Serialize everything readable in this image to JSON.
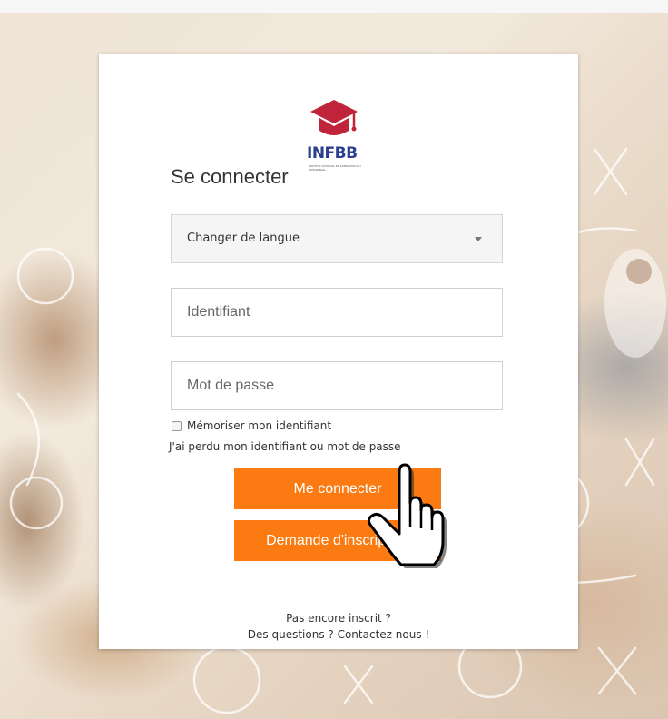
{
  "brand": {
    "logo_text": "INFBB",
    "logo_subtext": "INSTITUT NATIONAL DE FORMATION DU BASKETBALL",
    "primary_color": "#fb7b12",
    "logo_color": "#2c3e8f",
    "cap_color": "#c0243a"
  },
  "login": {
    "title": "Se connecter",
    "language_select": {
      "selected": "Changer de langue"
    },
    "username": {
      "placeholder": "Identifiant",
      "value": ""
    },
    "password": {
      "placeholder": "Mot de passe",
      "value": ""
    },
    "remember_label": "Mémoriser mon identifiant",
    "remember_checked": false,
    "lost_link": "J'ai perdu mon identifiant ou mot de passe",
    "login_button": "Me connecter",
    "register_button": "Demande d'inscription"
  },
  "footer": {
    "not_registered": "Pas encore inscrit ?",
    "contact": "Des questions ? Contactez nous !"
  },
  "icons": {
    "logo": "graduation-cap-icon",
    "cursor": "hand-pointer-icon",
    "select_caret": "caret-down-icon"
  }
}
